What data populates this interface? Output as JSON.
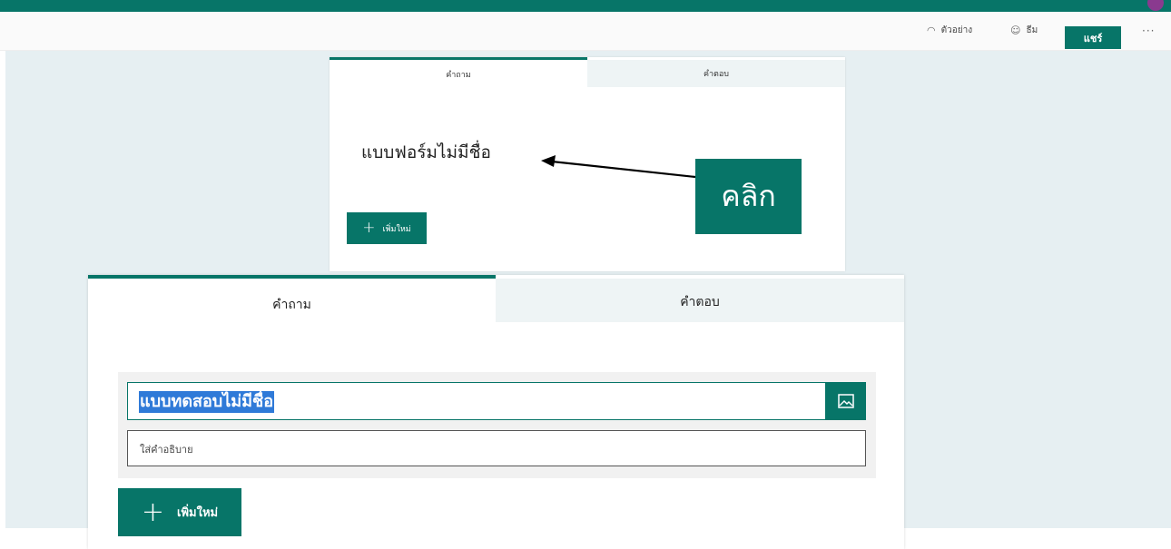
{
  "toolbar": {
    "preview_label": "ตัวอย่าง",
    "theme_label": "ธีม",
    "share_label": "แชร์",
    "more_label": "···"
  },
  "form_small": {
    "tab_questions": "คำถาม",
    "tab_responses": "คำตอบ",
    "form_title": "แบบฟอร์มไม่มีชื่อ",
    "add_new_label": "เพิ่มใหม่"
  },
  "annotation": {
    "click_label": "คลิก"
  },
  "form_zoom": {
    "tab_questions": "คำถาม",
    "tab_responses": "คำตอบ",
    "title_value": "แบบทดสอบไม่มีชื่อ",
    "description_placeholder": "ใส่คำอธิบาย",
    "add_new_label": "เพิ่มใหม่"
  },
  "colors": {
    "accent": "#077568",
    "canvas": "#e6eff2",
    "selection": "#2f7ad8"
  }
}
